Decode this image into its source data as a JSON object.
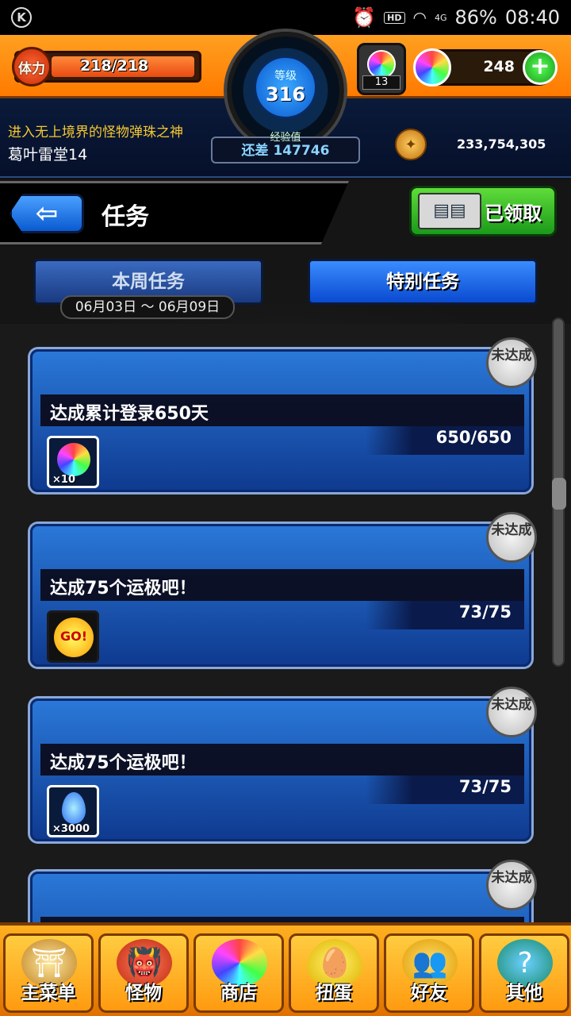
{
  "status_bar": {
    "icon_left": "K",
    "hd": "HD",
    "battery": "86%",
    "time": "08:40",
    "signal": "4G"
  },
  "player": {
    "stamina_label": "体力",
    "stamina": "218/218",
    "level_label": "等级",
    "level": "316",
    "exp_label": "经验值",
    "exp_remaining": "还差 147746",
    "gacha_count": "13",
    "orbs": "248",
    "title": "进入无上境界的怪物弹珠之神",
    "name": "葛叶雷堂14",
    "coins": "233,754,305"
  },
  "header": {
    "back_label": "⇦",
    "title": "任务",
    "collected_label": "已领取"
  },
  "tabs": {
    "weekly": "本周任务",
    "special": "特别任务",
    "date_range": "06月03日 ～ 06月09日"
  },
  "missions": [
    {
      "title": "达成累计登录650天",
      "progress": "650/650",
      "reward_icon": "rainbow-orb-icon",
      "reward_qty": "×10",
      "status": "未达成"
    },
    {
      "title": "达成75个运极吧！",
      "progress": "73/75",
      "reward_icon": "go-icon",
      "reward_qty": "",
      "status": "未达成"
    },
    {
      "title": "达成75个运极吧！",
      "progress": "73/75",
      "reward_icon": "blue-flame-icon",
      "reward_qty": "×3000",
      "status": "未达成"
    },
    {
      "title": "",
      "progress": "",
      "reward_icon": "",
      "reward_qty": "",
      "status": "未达成"
    }
  ],
  "nav": [
    {
      "label": "主菜单",
      "icon": "home-gate-icon"
    },
    {
      "label": "怪物",
      "icon": "monster-icon"
    },
    {
      "label": "商店",
      "icon": "shop-orb-icon"
    },
    {
      "label": "扭蛋",
      "icon": "gacha-egg-icon"
    },
    {
      "label": "好友",
      "icon": "friends-icon"
    },
    {
      "label": "其他",
      "icon": "other-icon"
    }
  ]
}
